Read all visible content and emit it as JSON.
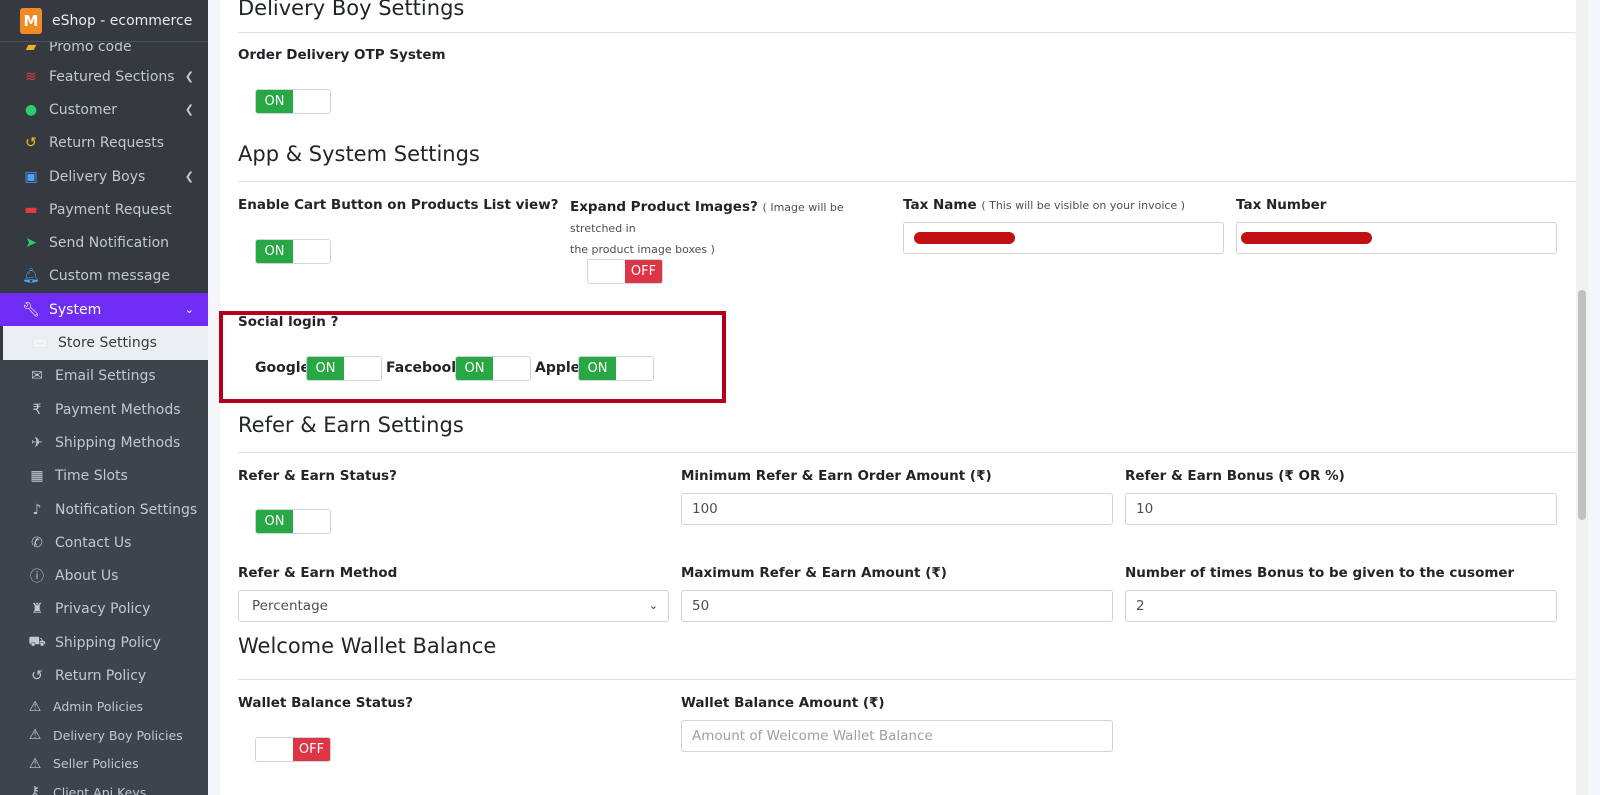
{
  "app": {
    "title": "eShop - ecommerce",
    "logo_letter": "M"
  },
  "sidebar": {
    "items": [
      {
        "label": "Promo code",
        "icon": "ticket-icon",
        "chevron": false
      },
      {
        "label": "Featured Sections",
        "icon": "layers-icon",
        "chevron": true
      },
      {
        "label": "Customer",
        "icon": "user-icon",
        "chevron": true
      },
      {
        "label": "Return Requests",
        "icon": "undo-icon",
        "chevron": false
      },
      {
        "label": "Delivery Boys",
        "icon": "id-badge-icon",
        "chevron": true
      },
      {
        "label": "Payment Request",
        "icon": "money-icon",
        "chevron": false
      },
      {
        "label": "Send Notification",
        "icon": "paper-plane-icon",
        "chevron": false
      },
      {
        "label": "Custom message",
        "icon": "bell-icon",
        "chevron": false
      },
      {
        "label": "System",
        "icon": "wrench-icon",
        "chevron": true,
        "active": true
      }
    ],
    "sub_items": [
      {
        "label": "Store Settings",
        "icon": "store-icon",
        "current": true
      },
      {
        "label": "Email Settings",
        "icon": "envelope-icon"
      },
      {
        "label": "Payment Methods",
        "icon": "rupee-icon"
      },
      {
        "label": "Shipping Methods",
        "icon": "rocket-icon"
      },
      {
        "label": "Time Slots",
        "icon": "calendar-icon"
      },
      {
        "label": "Notification Settings",
        "icon": "bell-icon"
      },
      {
        "label": "Contact Us",
        "icon": "phone-icon"
      },
      {
        "label": "About Us",
        "icon": "info-icon"
      },
      {
        "label": "Privacy Policy",
        "icon": "user-secret-icon"
      },
      {
        "label": "Shipping Policy",
        "icon": "truck-icon"
      },
      {
        "label": "Return Policy",
        "icon": "undo-icon"
      },
      {
        "label": "Admin Policies",
        "icon": "warning-icon"
      },
      {
        "label": "Delivery Boy Policies",
        "icon": "warning-icon"
      },
      {
        "label": "Seller Policies",
        "icon": "warning-icon"
      },
      {
        "label": "Client Api Keys",
        "icon": "key-icon"
      }
    ]
  },
  "sections": {
    "delivery_boy": {
      "title": "Delivery Boy Settings",
      "otp_label": "Order Delivery OTP System",
      "otp_state": "ON"
    },
    "app_system": {
      "title": "App & System Settings",
      "cart_label": "Enable Cart Button on Products List view?",
      "cart_state": "ON",
      "expand_label": "Expand Product Images?",
      "expand_note_1": "( Image will be stretched in",
      "expand_note_2": "the product image boxes )",
      "expand_state": "OFF",
      "tax_name_label": "Tax Name",
      "tax_name_note": "( This will be visible on your invoice )",
      "tax_number_label": "Tax Number"
    },
    "social": {
      "label": "Social login ?",
      "google": "Google",
      "google_state": "ON",
      "facebook": "Facebook",
      "facebook_state": "ON",
      "apple": "Apple",
      "apple_state": "ON"
    },
    "refer": {
      "title": "Refer & Earn Settings",
      "status_label": "Refer & Earn Status?",
      "status_state": "ON",
      "min_label": "Minimum Refer & Earn Order Amount (₹)",
      "min_value": "100",
      "bonus_label": "Refer & Earn Bonus (₹ OR %)",
      "bonus_value": "10",
      "method_label": "Refer & Earn Method",
      "method_value": "Percentage",
      "max_label": "Maximum Refer & Earn Amount (₹)",
      "max_value": "50",
      "times_label": "Number of times Bonus to be given to the cusomer",
      "times_value": "2"
    },
    "wallet": {
      "title": "Welcome Wallet Balance",
      "status_label": "Wallet Balance Status?",
      "status_state": "OFF",
      "amount_label": "Wallet Balance Amount (₹)",
      "amount_placeholder": "Amount of Welcome Wallet Balance"
    }
  },
  "colors": {
    "accent": "#6f2cf5",
    "on": "#28a745",
    "off": "#dc3545",
    "highlight": "#b0001c",
    "sidebar_bg": "#343a40"
  }
}
